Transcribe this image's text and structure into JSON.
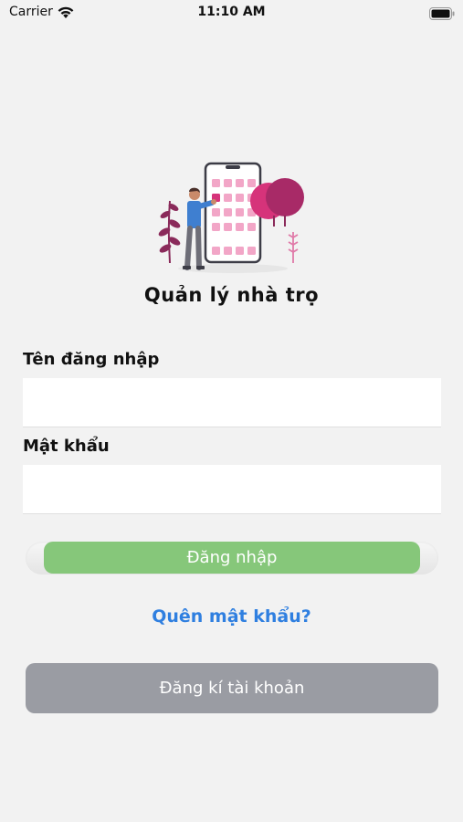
{
  "status_bar": {
    "carrier": "Carrier",
    "time": "11:10 AM",
    "wifi_icon": "wifi-icon",
    "battery_icon": "battery-icon"
  },
  "header": {
    "illustration": "person-with-phone-app-grid-illustration",
    "title": "Quản lý nhà trọ"
  },
  "form": {
    "username_label": "Tên đăng nhập",
    "username_value": "",
    "password_label": "Mật khẩu",
    "password_value": "",
    "login_label": "Đăng nhập",
    "forgot_label": "Quên mật khẩu?",
    "register_label": "Đăng kí tài khoản"
  },
  "colors": {
    "background": "#f2f2f2",
    "login_button": "#86c77a",
    "link": "#2f7fe0",
    "register_button": "#9a9ca3",
    "illustration_accent": "#d6337a"
  }
}
